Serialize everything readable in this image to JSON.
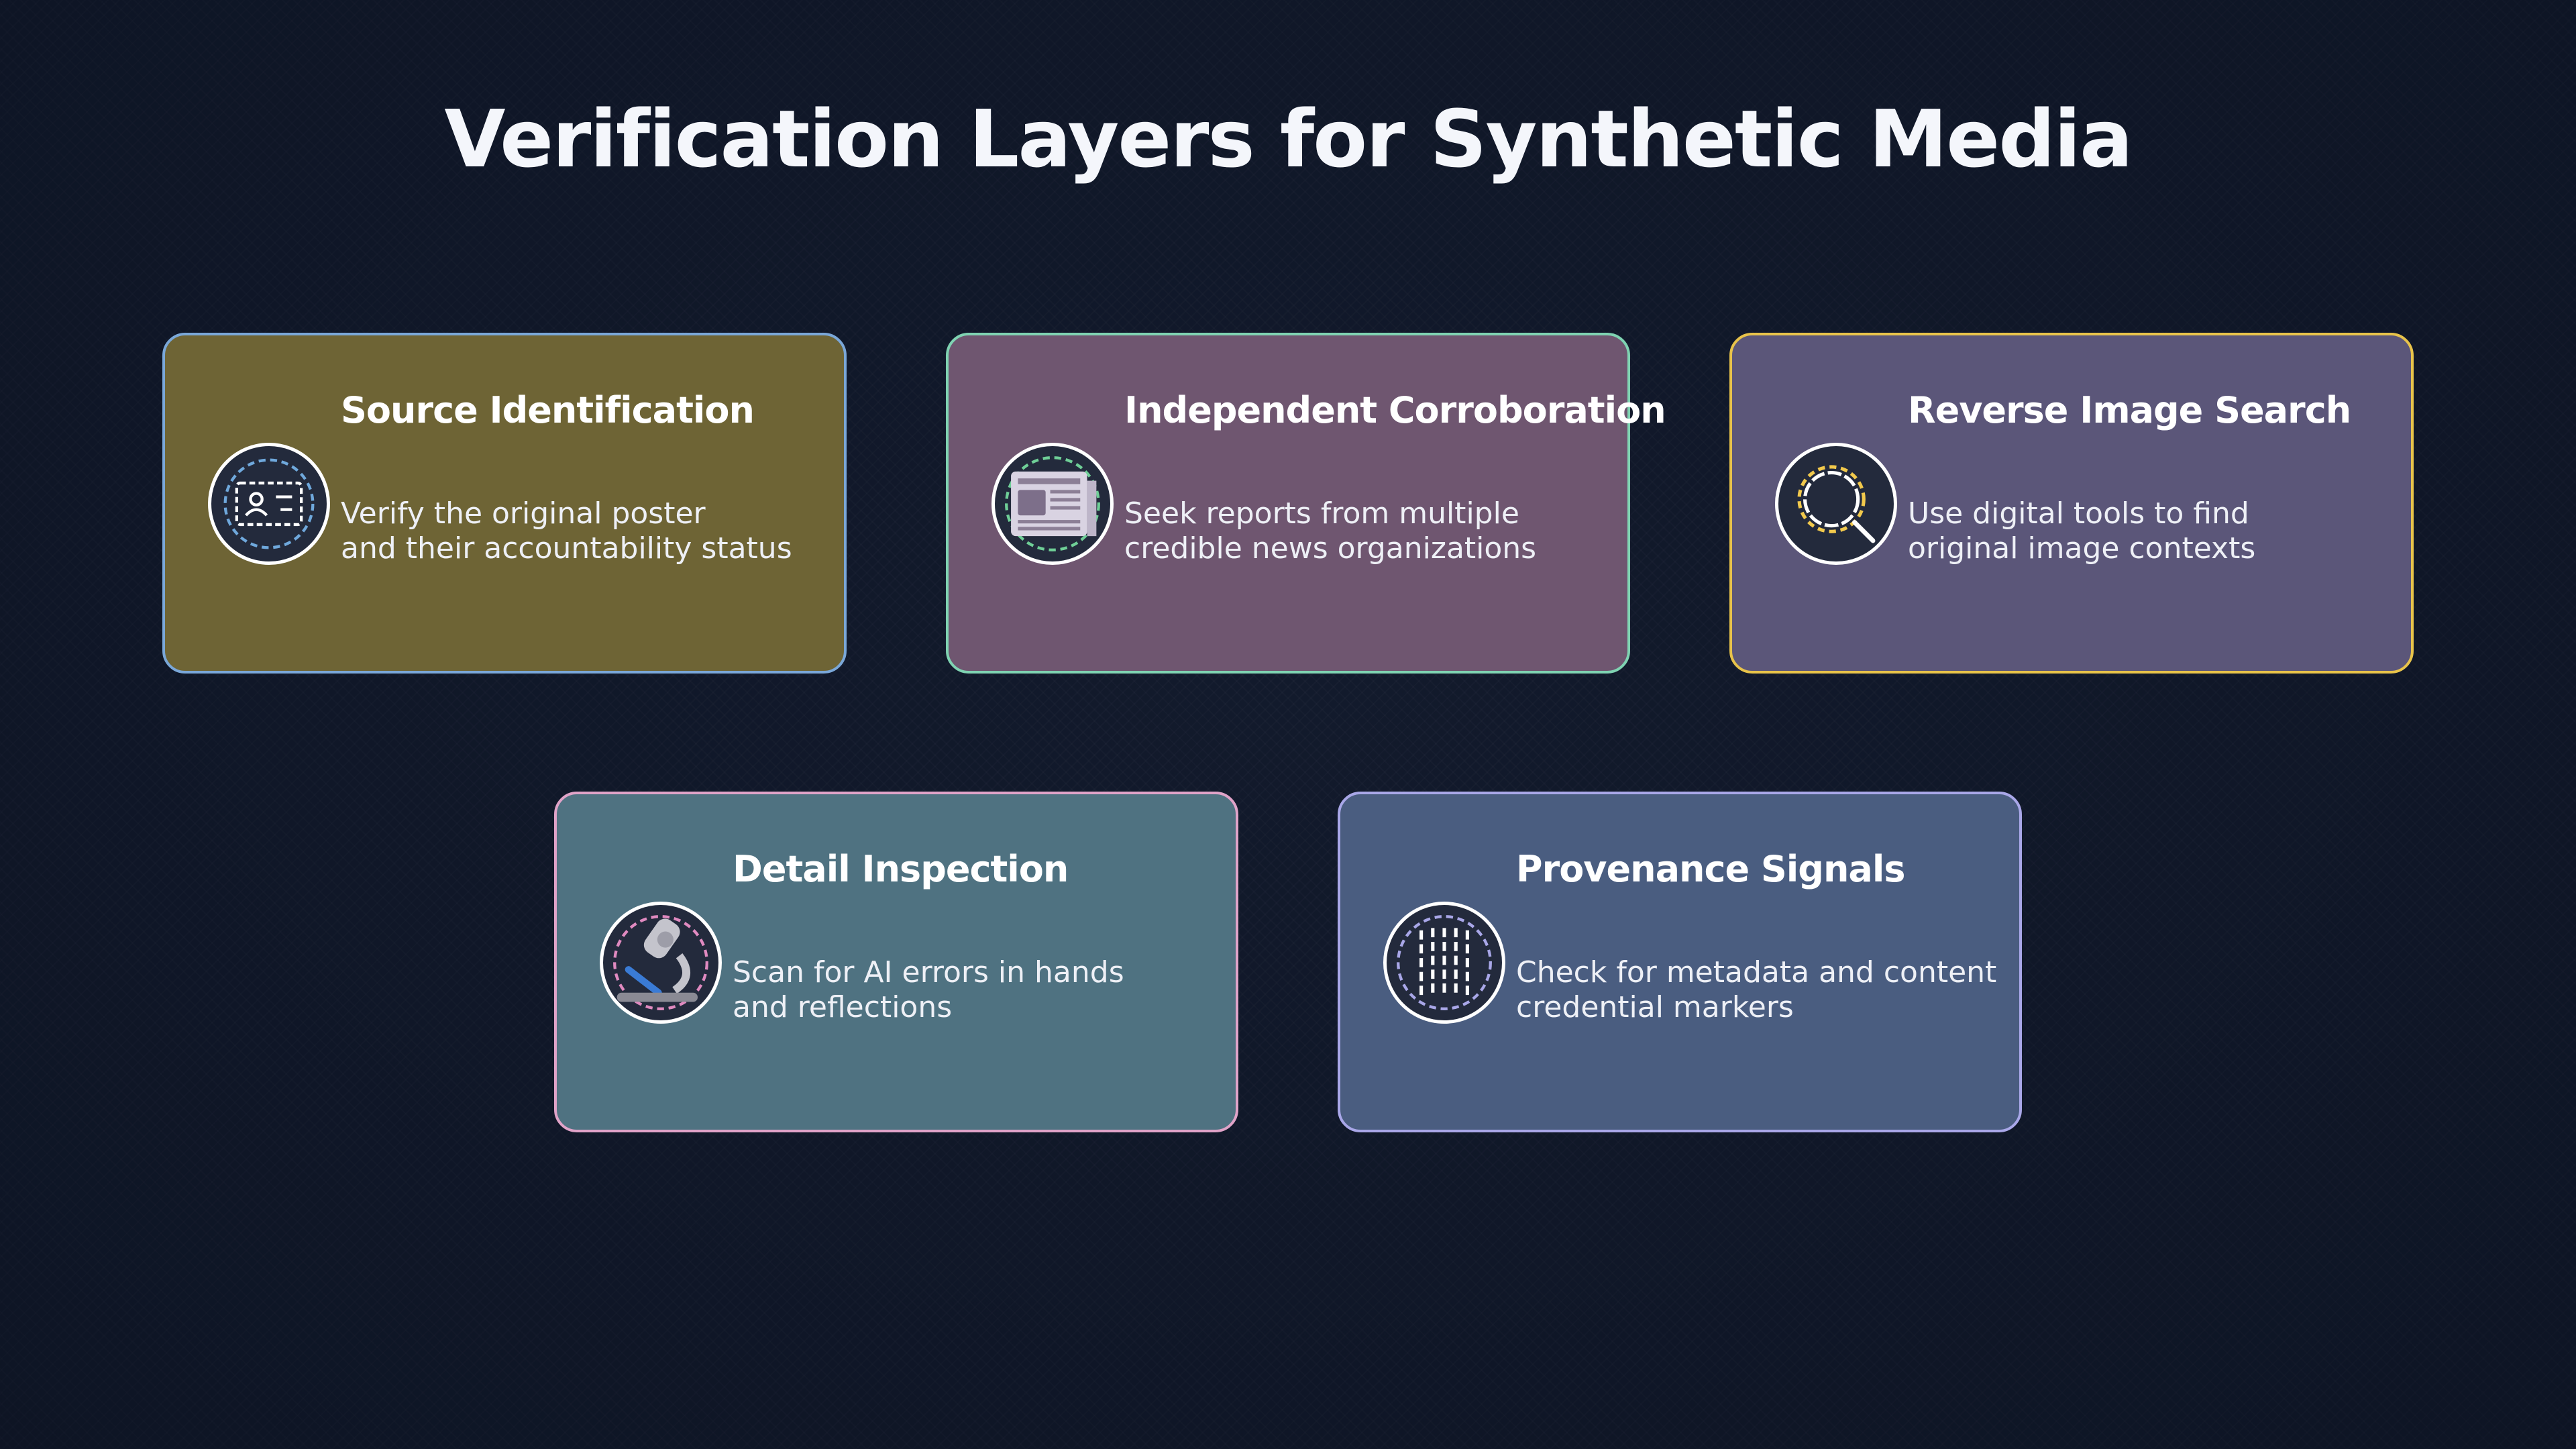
{
  "title": "Verification Layers for Synthetic Media",
  "cards": [
    {
      "title": "Source Identification",
      "desc_lines": [
        "Verify the original poster",
        "and their accountability status"
      ],
      "icon": "id-card-icon",
      "bg_color": "#6e6435",
      "border_color": "#7aa7d8",
      "accent_color": "#6fa8dc"
    },
    {
      "title": "Independent Corroboration",
      "desc_lines": [
        "Seek reports from multiple",
        "credible news organizations"
      ],
      "icon": "newspaper-icon",
      "bg_color": "#6f5670",
      "border_color": "#7fd3b2",
      "accent_color": "#6fcf97"
    },
    {
      "title": "Reverse Image Search",
      "desc_lines": [
        "Use digital tools to find",
        "original image contexts"
      ],
      "icon": "magnifier-icon",
      "bg_color": "#5b5679",
      "border_color": "#e8c34a",
      "accent_color": "#f2c94c"
    },
    {
      "title": "Detail Inspection",
      "desc_lines": [
        "Scan for AI errors in hands",
        "and reflections"
      ],
      "icon": "microscope-icon",
      "bg_color": "#4f7281",
      "border_color": "#e0a3c8",
      "accent_color": "#e08ac0"
    },
    {
      "title": "Provenance Signals",
      "desc_lines": [
        "Check for metadata and content",
        "credential markers"
      ],
      "icon": "barcode-icon",
      "bg_color": "#4a5d80",
      "border_color": "#a9a7e8",
      "accent_color": "#a9a7e8"
    }
  ]
}
